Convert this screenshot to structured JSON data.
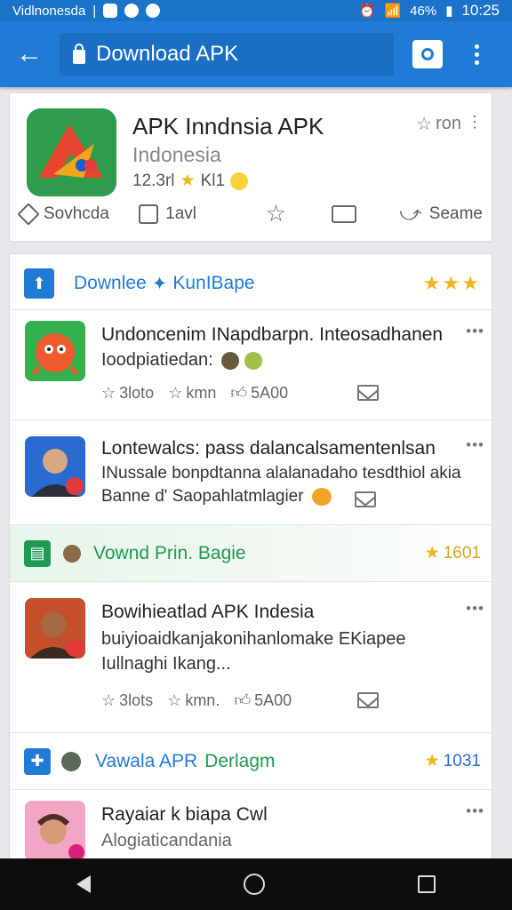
{
  "status": {
    "carrier": "Vidlnonesda",
    "signal": "46%",
    "time": "10:25"
  },
  "toolbar": {
    "url": "Download APK"
  },
  "app": {
    "title": "APK Inndnsia APK",
    "subtitle": "Indonesia",
    "meta_a": "12.3rl",
    "meta_b": "Kl1",
    "right_label": "ron",
    "actions": [
      "Sovhcda",
      "1avl",
      "",
      "",
      "Seame"
    ]
  },
  "sections": [
    {
      "title": "Downlee",
      "subtitle": "KunIBape",
      "right": "★★★",
      "color": "#1f7bd6",
      "accent": "#1f7bd6"
    },
    {
      "title": "Vownd Prin. Bagie",
      "right": "1601",
      "color": "#1e9b50",
      "accent": "#1e9b50"
    },
    {
      "title": "Vawala APR",
      "subtitle": "Derlagm",
      "right": "1031",
      "color": "#1f7bd6",
      "accent": "#1e9b50"
    }
  ],
  "items": [
    {
      "title": "Undoncenim INapdbarpn. Inteosadhanen",
      "text": "Ioodpiatiedan:",
      "a1": "3loto",
      "a2": "kmn",
      "a3": "5A00"
    },
    {
      "title": "Lontewalcs: pass dalancalsamentenlsan",
      "text": "INussale bonpdtanna alalanadaho tesdthiol akia",
      "text2": "Banne d' Saopahlatmlagier",
      "a1": "",
      "a2": "",
      "a3": ""
    },
    {
      "title": "Bowihieatlad APK Indesia",
      "text": "buiyioaidkanjakonihanlomake EKiapee",
      "text2": "Iullnaghi Ikang...",
      "a1": "3lots",
      "a2": "kmn.",
      "a3": "5A00"
    },
    {
      "title": "Rayaiar k biapa Cwl",
      "text": "Alogiaticandania"
    }
  ],
  "colors": {
    "appbar": "#1f7bd6",
    "statusbar": "#1a73c8"
  }
}
